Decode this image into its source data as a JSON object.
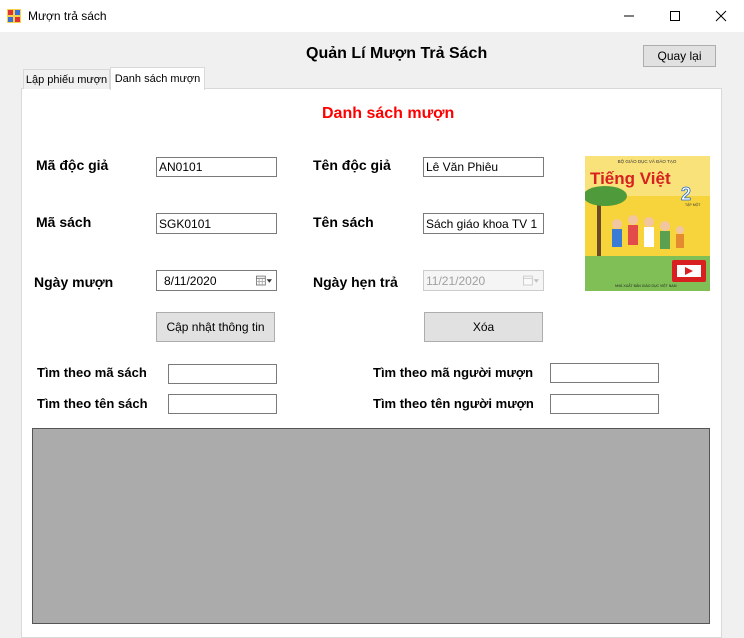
{
  "window": {
    "title": "Mượn trả sách"
  },
  "header": {
    "title": "Quản Lí Mượn Trả Sách",
    "back_button": "Quay lại"
  },
  "tabs": [
    {
      "label": "Lập phiếu mượn",
      "active": false
    },
    {
      "label": "Danh sách mượn",
      "active": true
    }
  ],
  "section": {
    "title": "Danh sách mượn"
  },
  "form": {
    "reader_id_label": "Mã độc giả",
    "reader_id_value": "AN0101",
    "reader_name_label": "Tên độc giả",
    "reader_name_value": "Lê Văn Phiêu",
    "book_id_label": "Mã sách",
    "book_id_value": "SGK0101",
    "book_name_label": "Tên sách",
    "book_name_value": "Sách giáo khoa TV 1",
    "borrow_date_label": "Ngày mượn",
    "borrow_date_value": "8/11/2020",
    "due_date_label": "Ngày hẹn trả",
    "due_date_value": "11/21/2020",
    "update_button": "Cập nhật thông tin",
    "delete_button": "Xóa"
  },
  "cover": {
    "publisher": "BỘ GIÁO DỤC VÀ ĐÀO TẠO",
    "title": "Tiếng Việt",
    "grade": "2",
    "volume": "TẬP MỘT",
    "footer": "NHÀ XUẤT BẢN GIÁO DỤC VIỆT NAM"
  },
  "search": {
    "by_book_id_label": "Tìm theo mã sách",
    "by_book_id_value": "",
    "by_book_name_label": "Tìm theo tên sách",
    "by_book_name_value": "",
    "by_reader_id_label": "Tìm theo mã người mượn",
    "by_reader_id_value": "",
    "by_reader_name_label": "Tìm theo tên người mượn",
    "by_reader_name_value": ""
  },
  "colors": {
    "section_title": "#ff0000",
    "grid_background": "#ababab"
  }
}
